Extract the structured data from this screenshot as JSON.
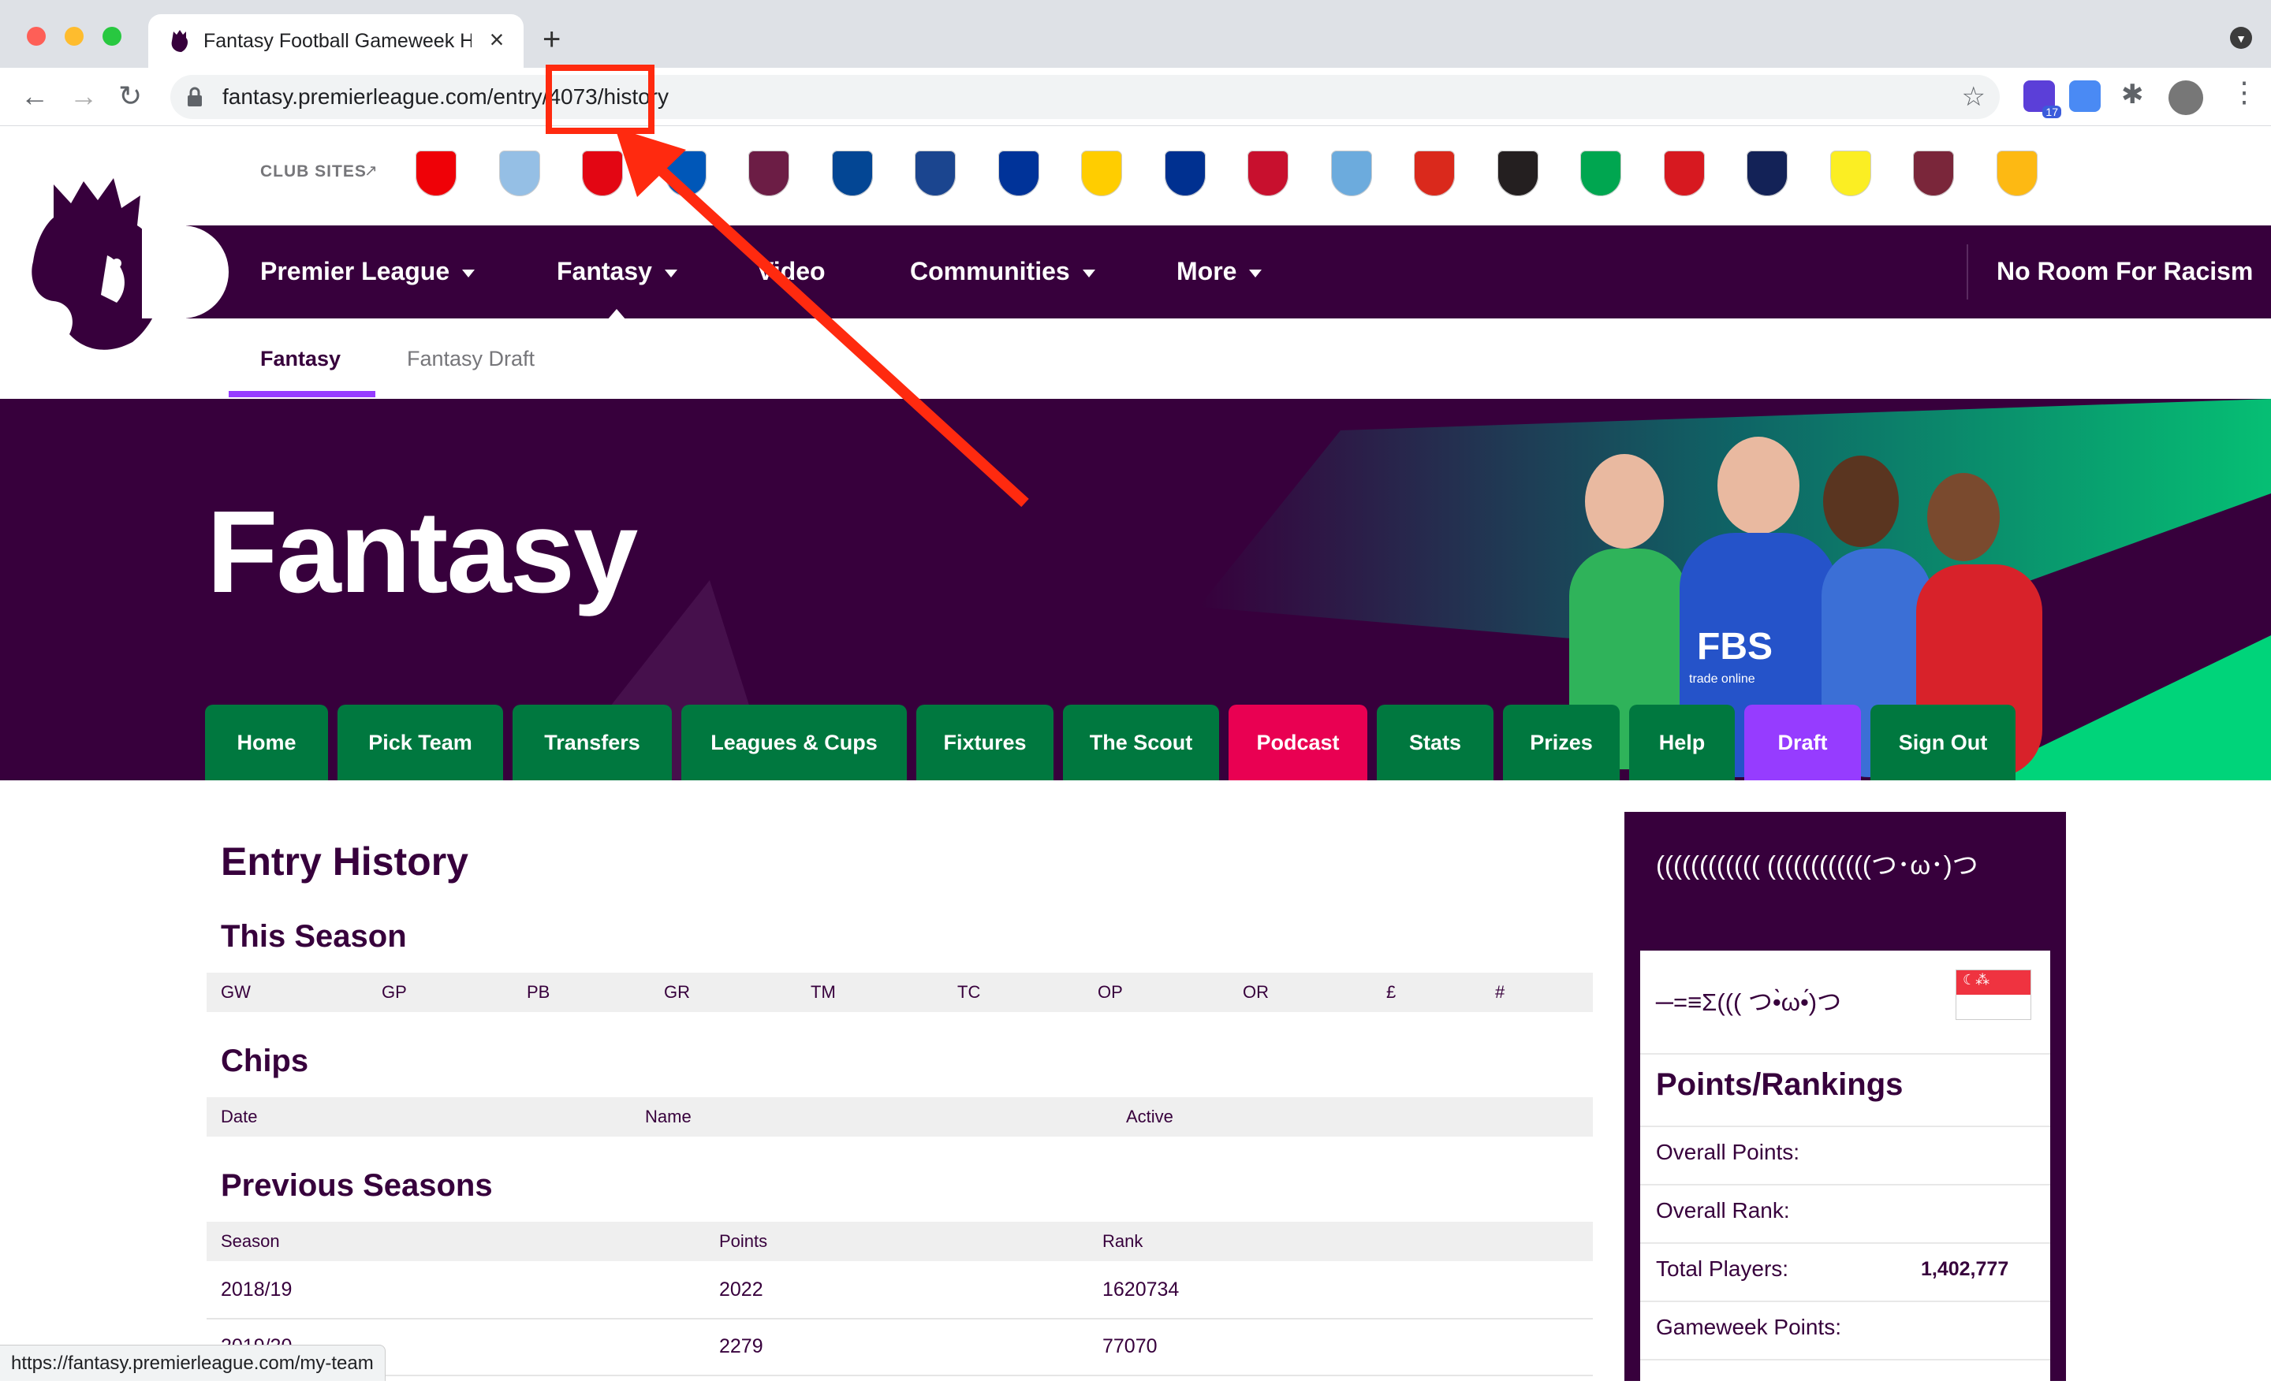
{
  "browser": {
    "tab_title": "Fantasy Football Gameweek Hi",
    "url_text": "fantasy.premierleague.com/entry/4073/history",
    "extension_badge": "17"
  },
  "header": {
    "club_sites_label": "CLUB SITES",
    "clubs": [
      "Arsenal",
      "Aston Villa",
      "Brentford",
      "Brighton",
      "Burnley",
      "Chelsea",
      "Crystal Palace",
      "Everton",
      "Leeds",
      "Leicester",
      "Liverpool",
      "Man City",
      "Man Utd",
      "Newcastle",
      "Norwich",
      "Southampton",
      "Spurs",
      "Watford",
      "West Ham",
      "Wolves"
    ],
    "nav": [
      "Premier League",
      "Fantasy",
      "Video",
      "Communities",
      "More"
    ],
    "nav_right": "No Room For Racism",
    "subnav": [
      "Fantasy",
      "Fantasy Draft"
    ]
  },
  "hero": {
    "title": "Fantasy",
    "tabs": [
      "Home",
      "Pick Team",
      "Transfers",
      "Leagues & Cups",
      "Fixtures",
      "The Scout",
      "Podcast",
      "Stats",
      "Prizes",
      "Help",
      "Draft",
      "Sign Out"
    ],
    "jersey_text": "FBS",
    "jersey_sub": "trade online"
  },
  "content": {
    "heading": "Entry History",
    "this_season": {
      "title": "This Season",
      "headers": [
        "GW",
        "GP",
        "PB",
        "GR",
        "TM",
        "TC",
        "OP",
        "OR",
        "£",
        "#"
      ]
    },
    "chips": {
      "title": "Chips",
      "headers": [
        "Date",
        "Name",
        "Active"
      ]
    },
    "previous": {
      "title": "Previous Seasons",
      "headers": [
        "Season",
        "Points",
        "Rank"
      ],
      "rows": [
        {
          "season": "2018/19",
          "points": "2022",
          "rank": "1620734"
        },
        {
          "season": "2019/20",
          "points": "2279",
          "rank": "77070"
        }
      ]
    }
  },
  "sidebar": {
    "team_name": "(((((((((((( ((((((((((((つ･ω･)つ",
    "manager": "─=≡Σ((( つ•̀ω•́)つ",
    "heading": "Points/Rankings",
    "rows": [
      {
        "label": "Overall Points:",
        "value": ""
      },
      {
        "label": "Overall Rank:",
        "value": ""
      },
      {
        "label": "Total Players:",
        "value": "1,402,777"
      },
      {
        "label": "Gameweek Points:",
        "value": ""
      }
    ]
  },
  "status_url": "https://fantasy.premierleague.com/my-team",
  "colors": {
    "brand_purple": "#37003c",
    "tab_green": "#00783f",
    "podcast_pink": "#e90052",
    "draft_violet": "#963cff",
    "annotation_red": "#ff2a0f"
  }
}
